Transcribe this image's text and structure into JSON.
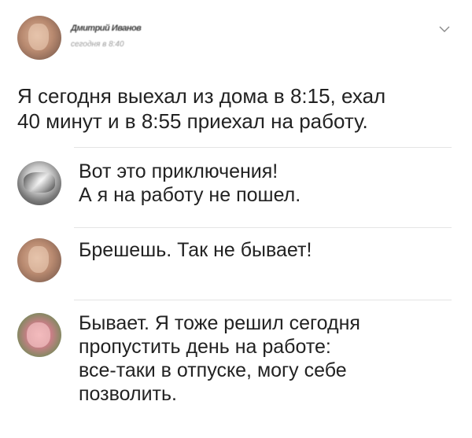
{
  "post": {
    "author_name": "Дмитрий Иванов",
    "author_meta": "сегодня в 8:40",
    "text_lines": [
      "Я сегодня выехал из дома в 8:15, ехал",
      "40 минут и в 8:55 приехал на работу."
    ],
    "icons": {
      "avatar": "avatar-photo",
      "menu": "chevron-down-icon"
    }
  },
  "comments": [
    {
      "avatar": "avatar-photo",
      "lines": [
        "Вот это приключения!",
        "А я на работу не пошел."
      ]
    },
    {
      "avatar": "avatar-photo",
      "lines": [
        "Брешешь. Так не бывает!"
      ]
    },
    {
      "avatar": "avatar-photo",
      "lines": [
        "Бывает. Я тоже решил сегодня",
        "пропустить день на работе:",
        "все-таки в отпуске, могу себе",
        "позволить."
      ]
    }
  ],
  "colors": {
    "text": "#222222",
    "divider": "#e4e4e4",
    "chevron": "#8a8a8a"
  }
}
